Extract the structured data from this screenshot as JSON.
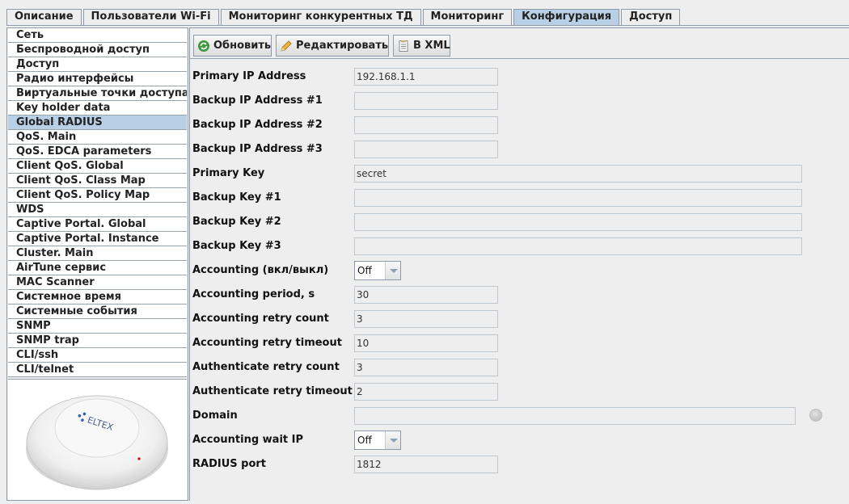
{
  "tabs": [
    {
      "label": "Описание",
      "active": false
    },
    {
      "label": "Пользователи Wi-Fi",
      "active": false
    },
    {
      "label": "Мониторинг конкурентных ТД",
      "active": false
    },
    {
      "label": "Мониторинг",
      "active": false
    },
    {
      "label": "Конфигурация",
      "active": true
    },
    {
      "label": "Доступ",
      "active": false
    }
  ],
  "sidebar": {
    "items": [
      "Сеть",
      "Беспроводной доступ",
      "Доступ",
      "Радио интерфейсы",
      "Виртуальные точки доступа",
      "Key holder data",
      "Global RADIUS",
      "QoS. Main",
      "QoS. EDCA parameters",
      "Client QoS. Global",
      "Client QoS. Class Map",
      "Client QoS. Policy Map",
      "WDS",
      "Captive Portal. Global",
      "Captive Portal. Instance",
      "Cluster. Main",
      "AirTune сервис",
      "MAC Scanner",
      "Системное время",
      "Системные события",
      "SNMP",
      "SNMP trap",
      "CLI/ssh",
      "CLI/telnet"
    ],
    "selected_index": 6,
    "device_logo": "ELTEX"
  },
  "toolbar": {
    "refresh_label": "Обновить",
    "edit_label": "Редактировать",
    "xml_label": "В XML",
    "refresh_icon": "refresh-icon",
    "edit_icon": "pencil-icon",
    "xml_icon": "document-icon"
  },
  "form": {
    "primary_ip": {
      "label": "Primary IP Address",
      "value": "192.168.1.1"
    },
    "backup_ip_1": {
      "label": "Backup IP Address #1",
      "value": ""
    },
    "backup_ip_2": {
      "label": "Backup IP Address #2",
      "value": ""
    },
    "backup_ip_3": {
      "label": "Backup IP Address #3",
      "value": ""
    },
    "primary_key": {
      "label": "Primary Key",
      "value": "secret"
    },
    "backup_key_1": {
      "label": "Backup Key #1",
      "value": ""
    },
    "backup_key_2": {
      "label": "Backup Key #2",
      "value": ""
    },
    "backup_key_3": {
      "label": "Backup Key #3",
      "value": ""
    },
    "accounting": {
      "label": "Accounting (вкл/выкл)",
      "value": "Off"
    },
    "accounting_period": {
      "label": "Accounting period, s",
      "value": "30"
    },
    "accounting_retry_count": {
      "label": "Accounting retry count",
      "value": "3"
    },
    "accounting_retry_timeout": {
      "label": "Accounting retry timeout",
      "value": "10"
    },
    "authenticate_retry_count": {
      "label": "Authenticate retry count",
      "value": "3"
    },
    "authenticate_retry_timeout": {
      "label": "Authenticate retry timeout",
      "value": "2"
    },
    "domain": {
      "label": "Domain",
      "value": ""
    },
    "accounting_wait_ip": {
      "label": "Accounting wait IP",
      "value": "Off"
    },
    "radius_port": {
      "label": "RADIUS port",
      "value": "1812"
    }
  },
  "colors": {
    "active_tab": "#b8cfe5",
    "selected_nav": "#b8cfe5",
    "background": "#eeeeee",
    "border": "#8e9aa8"
  }
}
